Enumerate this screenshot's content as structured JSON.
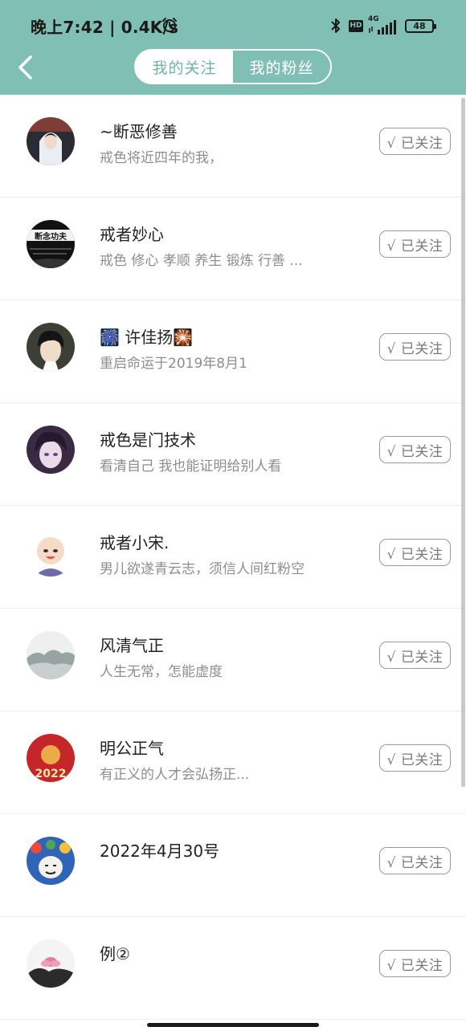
{
  "status_bar": {
    "time": "晚上7:42 | 0.4K/s",
    "hd": "HD",
    "network": "4G",
    "battery": "48"
  },
  "header": {
    "tabs": [
      {
        "label": "我的关注",
        "active": false
      },
      {
        "label": "我的粉丝",
        "active": true
      }
    ],
    "accent_color": "#80bfb4"
  },
  "users": [
    {
      "name": "~断恶修善",
      "bio": "戒色将近四年的我，",
      "follow_label": "√ 已关注"
    },
    {
      "name": "戒者妙心",
      "bio": "戒色  修心  孝顺  养生  锻炼  行善 ...",
      "follow_label": "√ 已关注"
    },
    {
      "name": "🎆 许佳扬🎇",
      "bio": "重启命运于2019年8月1",
      "follow_label": "√ 已关注"
    },
    {
      "name": "戒色是门技术",
      "bio": "看清自己 我也能证明给别人看",
      "follow_label": "√ 已关注"
    },
    {
      "name": "戒者小宋.",
      "bio": "男儿欲遂青云志，须信人间红粉空",
      "follow_label": "√ 已关注"
    },
    {
      "name": "风清气正",
      "bio": "人生无常，怎能虚度",
      "follow_label": "√ 已关注"
    },
    {
      "name": "明公正气",
      "bio": "有正义的人才会弘扬正...",
      "follow_label": "√ 已关注"
    },
    {
      "name": "2022年4月30号",
      "bio": "",
      "follow_label": "√ 已关注"
    },
    {
      "name": "例②",
      "bio": "",
      "follow_label": "√ 已关注"
    }
  ],
  "avatar_texts": {
    "avatar_2": "断念功夫",
    "avatar_7": "2022"
  }
}
